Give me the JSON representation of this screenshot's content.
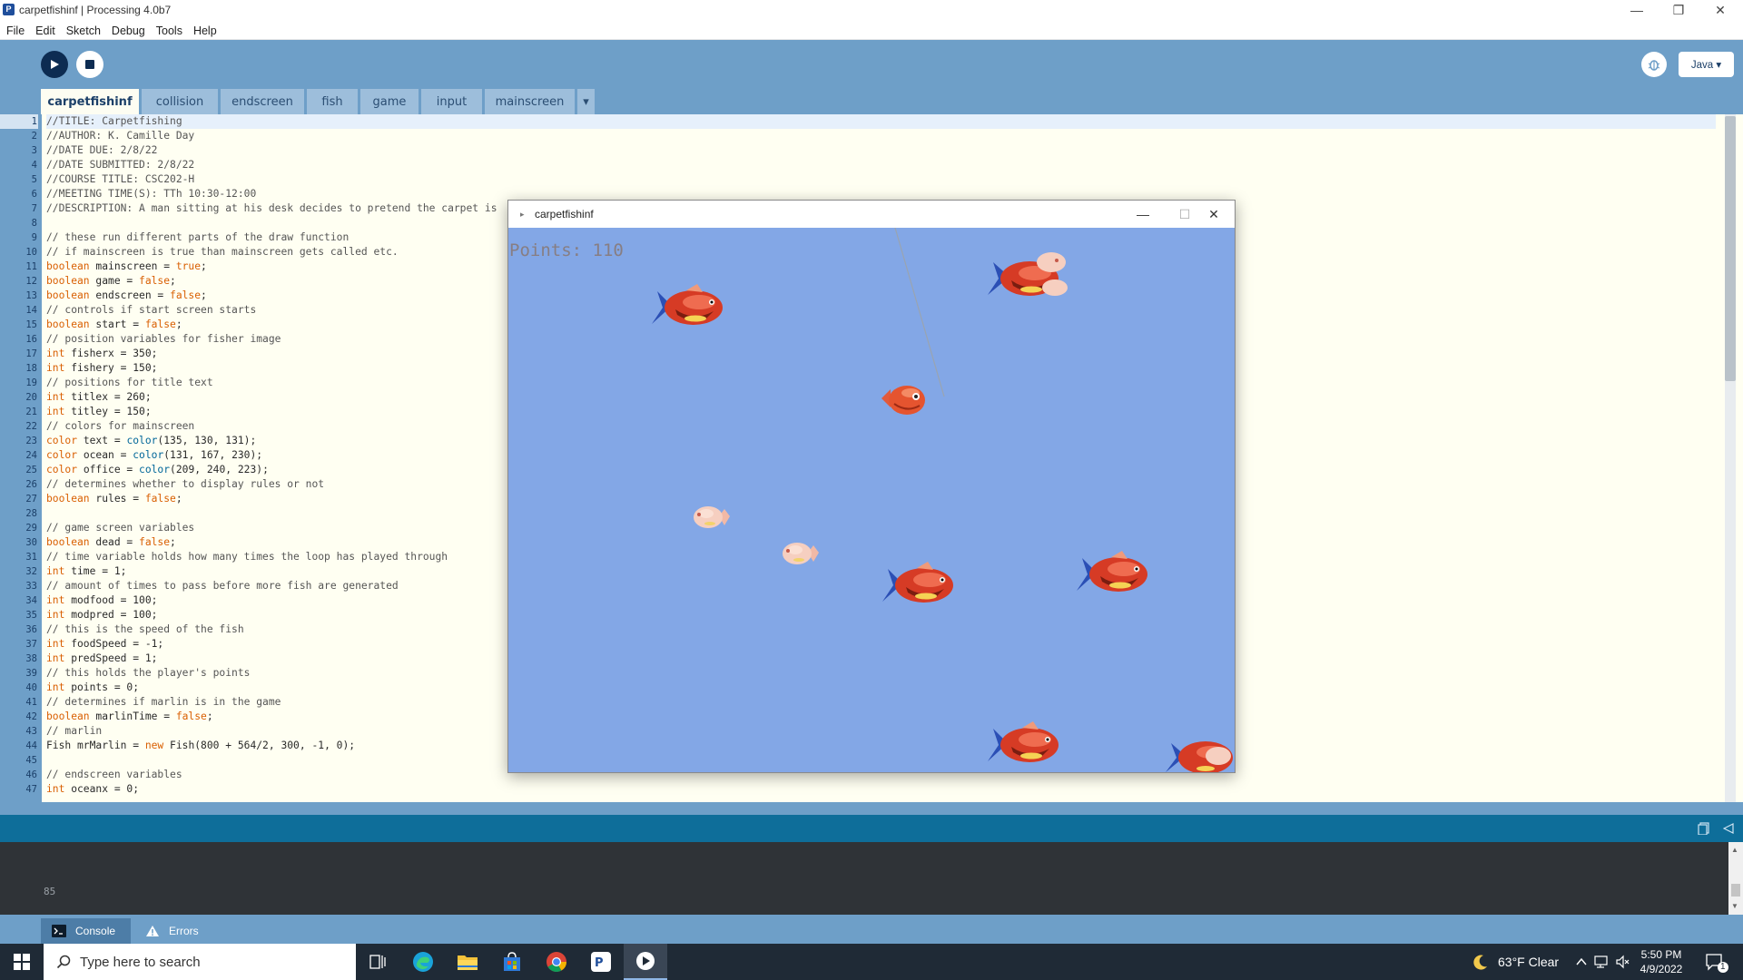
{
  "window": {
    "title": "carpetfishinf | Processing 4.0b7"
  },
  "menu": [
    "File",
    "Edit",
    "Sketch",
    "Debug",
    "Tools",
    "Help"
  ],
  "toolbar": {
    "mode_label": "Java ▾"
  },
  "tabs": [
    "carpetfishinf",
    "collision",
    "endscreen",
    "fish",
    "game",
    "input",
    "mainscreen"
  ],
  "tabs_more": "▾",
  "editor": {
    "current_line": 1,
    "lines": [
      "//TITLE: Carpetfishing",
      "//AUTHOR: K. Camille Day",
      "//DATE DUE: 2/8/22",
      "//DATE SUBMITTED: 2/8/22",
      "//COURSE TITLE: CSC202-H",
      "//MEETING TIME(S): TTh 10:30-12:00",
      "//DESCRIPTION: A man sitting at his desk decides to pretend the carpet is",
      "",
      "// these run different parts of the draw function",
      "// if mainscreen is true than mainscreen gets called etc.",
      "boolean mainscreen = true;",
      "boolean game = false;",
      "boolean endscreen = false;",
      "// controls if start screen starts",
      "boolean start = false;",
      "// position variables for fisher image",
      "int fisherx = 350;",
      "int fishery = 150;",
      "// positions for title text",
      "int titlex = 260;",
      "int titley = 150;",
      "// colors for mainscreen",
      "color text = color(135, 130, 131);",
      "color ocean = color(131, 167, 230);",
      "color office = color(209, 240, 223);",
      "// determines whether to display rules or not",
      "boolean rules = false;",
      "",
      "// game screen variables",
      "boolean dead = false;",
      "// time variable holds how many times the loop has played through",
      "int time = 1;",
      "// amount of times to pass before more fish are generated",
      "int modfood = 100;",
      "int modpred = 100;",
      "// this is the speed of the fish",
      "int foodSpeed = -1;",
      "int predSpeed = 1;",
      "// this holds the player's points",
      "int points = 0;",
      "// determines if marlin is in the game",
      "boolean marlinTime = false;",
      "// marlin",
      "Fish mrMarlin = new Fish(800 + 564/2, 300, -1, 0);",
      "",
      "// endscreen variables",
      "int oceanx = 0;"
    ]
  },
  "sketch_window": {
    "title": "carpetfishinf",
    "points_text": "Points: 110"
  },
  "console": {
    "output": "85",
    "tabs": [
      "Console",
      "Errors"
    ]
  },
  "taskbar": {
    "search_placeholder": "Type here to search",
    "weather": "63°F  Clear",
    "time": "5:50 PM",
    "date": "4/9/2022",
    "notification_count": "1"
  },
  "colors": {
    "toolbar": "#6e9fc8",
    "editor_bg": "#fffff2",
    "ocean": "#83a7e6",
    "console_bg": "#2f3337",
    "keyword": "#d95f02"
  }
}
